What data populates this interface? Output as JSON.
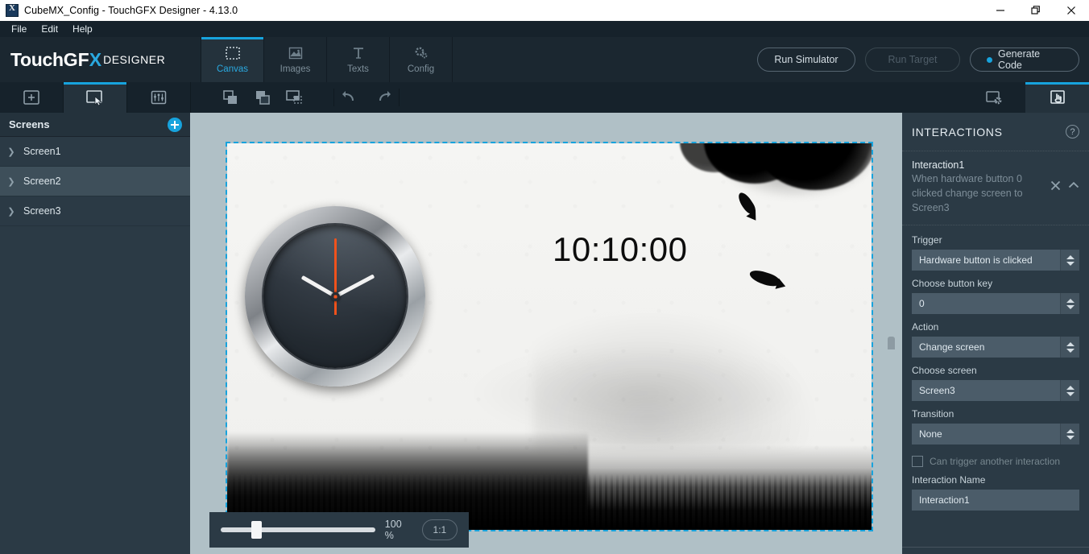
{
  "window": {
    "title": "CubeMX_Config - TouchGFX Designer - 4.13.0",
    "app_icon": "stm-cube-icon",
    "controls": {
      "minimize": "minimize-icon",
      "restore": "restore-icon",
      "close": "close-icon"
    }
  },
  "menubar": {
    "items": [
      {
        "label": "File"
      },
      {
        "label": "Edit"
      },
      {
        "label": "Help"
      }
    ]
  },
  "brand": {
    "part1": "Touch",
    "part2": "GF",
    "part3": "X",
    "suffix": "DESIGNER"
  },
  "top_tabs": [
    {
      "label": "Canvas",
      "icon": "dotted-square-icon",
      "active": true
    },
    {
      "label": "Images",
      "icon": "picture-icon",
      "active": false
    },
    {
      "label": "Texts",
      "icon": "text-t-icon",
      "active": false
    },
    {
      "label": "Config",
      "icon": "gears-icon",
      "active": false
    }
  ],
  "top_actions": {
    "run_simulator": "Run Simulator",
    "run_target": "Run Target",
    "generate_code": "Generate Code",
    "accent_color": "#17a3dd"
  },
  "toolbar2": {
    "add": "add-widget-icon",
    "select": "screen-cursor-icon",
    "properties": "sliders-icon",
    "bring_front": "bring-to-front-icon",
    "send_back": "send-to-back-icon",
    "snapshot": "screen-overlay-icon",
    "undo": "undo-icon",
    "redo": "redo-icon",
    "screen_settings": "screen-gear-icon",
    "interactions": "interactions-hand-icon"
  },
  "sidebar": {
    "title": "Screens",
    "add_button": "add-screen-icon",
    "items": [
      {
        "label": "Screen1",
        "selected": false
      },
      {
        "label": "Screen2",
        "selected": true
      },
      {
        "label": "Screen3",
        "selected": false
      }
    ]
  },
  "canvas": {
    "digital_clock": "10:10:00",
    "analog_clock": {
      "hour": 10,
      "minute": 10,
      "second": 0,
      "second_hand_color": "#f0521c"
    },
    "selection_color": "#17a3dd",
    "zoom": {
      "percent": "100 %",
      "fit_button": "1:1",
      "slider_value": 20
    }
  },
  "interactions_panel": {
    "title": "INTERACTIONS",
    "help_icon": "help-circle-icon",
    "item": {
      "name": "Interaction1",
      "description": "When hardware button 0 clicked change screen to Screen3",
      "delete_icon": "close-icon",
      "collapse_icon": "chevron-up-icon"
    },
    "fields": [
      {
        "label": "Trigger",
        "value": "Hardware button is clicked",
        "type": "select"
      },
      {
        "label": "Choose button key",
        "value": "0",
        "type": "select"
      },
      {
        "label": "Action",
        "value": "Change screen",
        "type": "select"
      },
      {
        "label": "Choose screen",
        "value": "Screen3",
        "type": "select"
      },
      {
        "label": "Transition",
        "value": "None",
        "type": "select"
      }
    ],
    "checkbox": {
      "label": "Can trigger another interaction",
      "checked": false
    },
    "name_field": {
      "label": "Interaction Name",
      "value": "Interaction1"
    }
  }
}
